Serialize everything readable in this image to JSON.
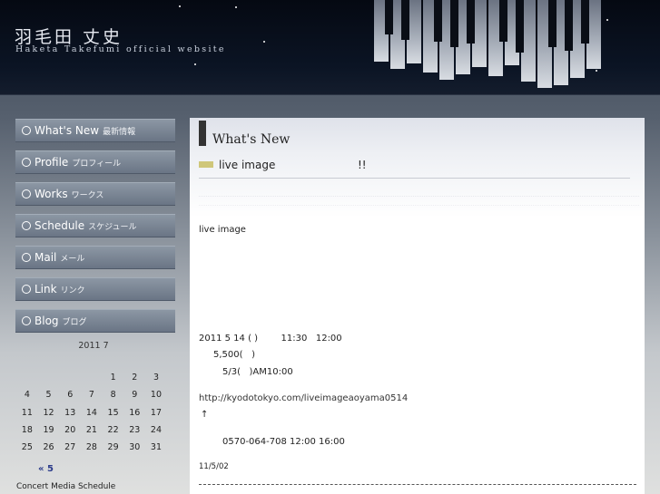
{
  "header": {
    "title_jp": "羽毛田 丈史",
    "title_en": "Haketa Takefumi official website"
  },
  "nav": {
    "items": [
      {
        "en": "What's New",
        "jp": "最新情報"
      },
      {
        "en": "Profile",
        "jp": "プロフィール"
      },
      {
        "en": "Works",
        "jp": "ワークス"
      },
      {
        "en": "Schedule",
        "jp": "スケジュール"
      },
      {
        "en": "Mail",
        "jp": "メール"
      },
      {
        "en": "Link",
        "jp": "リンク"
      },
      {
        "en": "Blog",
        "jp": "ブログ"
      }
    ]
  },
  "calendar": {
    "title": "2011 7",
    "weeks": [
      [
        "",
        "",
        "",
        "",
        "1",
        "2",
        "3"
      ],
      [
        "4",
        "5",
        "6",
        "7",
        "8",
        "9",
        "10"
      ],
      [
        "11",
        "12",
        "13",
        "14",
        "15",
        "16",
        "17"
      ],
      [
        "18",
        "19",
        "20",
        "21",
        "22",
        "23",
        "24"
      ],
      [
        "25",
        "26",
        "27",
        "28",
        "29",
        "30",
        "31"
      ]
    ],
    "prev": "« 5"
  },
  "sidebar_footer": "Concert Media Schedule",
  "main": {
    "heading": "What's New",
    "post_title": "live image",
    "post_title_suffix": "!!",
    "lines": {
      "l1": "live image",
      "l2": "2011 5 14 ( )        11:30   12:00",
      "l3": "5,500(   )",
      "l4": "5/3(   )AM10:00",
      "link": "http://kyodotokyo.com/liveimageaoyama0514",
      "arrow": "↑",
      "phone": "0570-064-708 12:00 16:00",
      "date": "11/5/02"
    }
  },
  "colors": {
    "header_bg": "#0b1424",
    "nav_button": "#7a8595",
    "post_marker": "#cfc77a"
  }
}
